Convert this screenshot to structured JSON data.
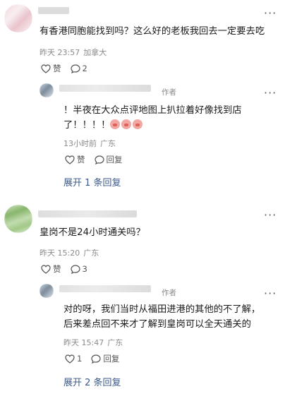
{
  "comments": [
    {
      "text": "有香港同胞能找到吗？这么好的老板我回去一定要去吃",
      "time": "昨天 23:57",
      "location": "加拿大",
      "like_label": "赞",
      "reply_count": "2",
      "reply": {
        "author_tag": "作者",
        "text_line1": "！半夜在大众点评地图上扒拉着好像找到店",
        "text_line2": "了！！！！",
        "time": "13小时前",
        "location": "广东",
        "like_label": "赞",
        "reply_label": "回复"
      },
      "expand_label": "展开 1 条回复"
    },
    {
      "text": "皇岗不是24小时通关吗？",
      "time": "昨天 15:20",
      "location": "广东",
      "like_label": "赞",
      "reply_count": "3",
      "reply": {
        "author_tag": "作者",
        "text_line1": "对的呀，我们当时从福田进港的其他的不了解，",
        "text_line2": "后来差点回不来才了解到皇岗可以全天通关的",
        "time": "昨天 15:47",
        "location": "广东",
        "like_count": "1",
        "reply_label": "回复"
      },
      "expand_label": "展开 2 条回复"
    }
  ],
  "icons": {
    "more": "more-dots-icon",
    "like": "heart-icon",
    "comment": "comment-bubble-icon",
    "emoji": "pig-face-emoji"
  }
}
